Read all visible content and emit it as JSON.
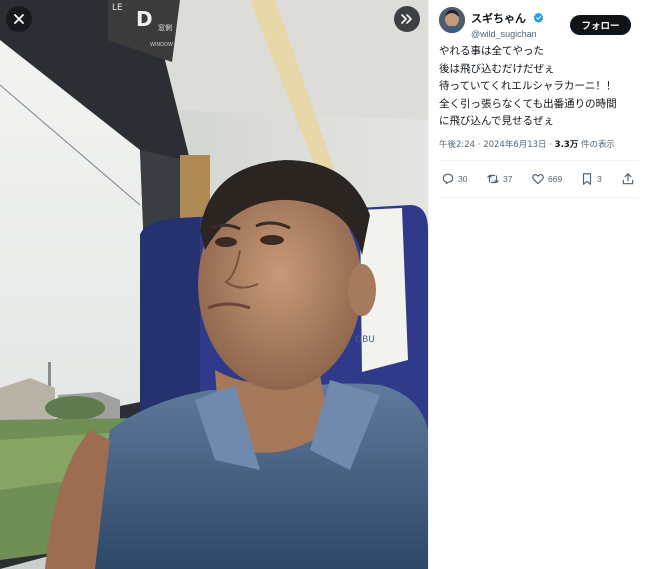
{
  "viewer": {
    "close_icon": "close-icon",
    "expand_icon": "double-chevron-right-icon",
    "window_sign_letter": "D",
    "window_sign_small_a": "LE",
    "window_sign_small_b": "窓側",
    "window_sign_small_c": "WINDOW",
    "seat_cover_text": "OBU"
  },
  "post": {
    "display_name": "スギちゃん",
    "handle": "@wild_sugichan",
    "follow_label": "フォロー",
    "text": "やれる事は全てやった\n後は飛び込むだけだぜぇ\n待っていてくれエルシャラカーニ！！\n全く引っ張らなくても出番通りの時間\nに飛び込んで見せるぜぇ",
    "time": "午後2:24",
    "date": "2024年6月13日",
    "views_count": "3.3万",
    "views_label": "件の表示",
    "separator": "·",
    "replies": "30",
    "reposts": "37",
    "likes": "669",
    "bookmarks": "3"
  },
  "colors": {
    "text_primary": "#0f1419",
    "text_secondary": "#536471",
    "verified_blue": "#1d9bf0",
    "follow_bg": "#0f1419"
  }
}
